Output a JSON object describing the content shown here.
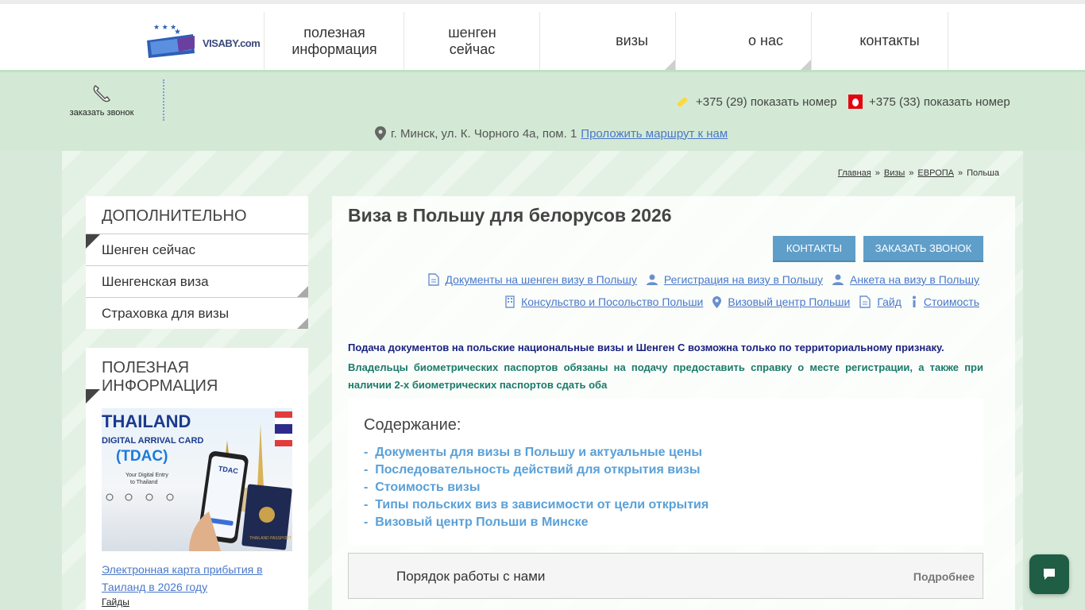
{
  "logo": {
    "text": "VISABY.com"
  },
  "nav": {
    "items": [
      {
        "line1": "полезная",
        "line2": "информация"
      },
      {
        "line1": "шенген",
        "line2": "сейчас"
      },
      {
        "line1": "визы",
        "line2": ""
      },
      {
        "line1": "о нас",
        "line2": ""
      },
      {
        "line1": "контакты",
        "line2": ""
      }
    ]
  },
  "topbar": {
    "callback_label": "заказать звонок",
    "phone1": {
      "number": "+375 (29)",
      "action": "показать номер"
    },
    "phone2": {
      "number": "+375 (33)",
      "action": "показать номер"
    },
    "address": "г. Минск, ул. К. Чорного 4а, пом. 1",
    "route_link": "Проложить маршрут к нам"
  },
  "breadcrumb": {
    "items": [
      "Главная",
      "Визы",
      "ЕВРОПА"
    ],
    "current": "Польша",
    "separator": "»"
  },
  "sidebar": {
    "extra_title": "ДОПОЛНИТЕЛЬНО",
    "extra_items": [
      "Шенген сейчас",
      "Шенгенская виза",
      "Страховка для визы"
    ],
    "info_title": "ПОЛЕЗНАЯ ИНФОРМАЦИЯ",
    "promo": {
      "line1": "THAILAND",
      "line2": "DIGITAL ARRIVAL CARD",
      "line3": "(TDAC)",
      "line4": "Your Digital Entry",
      "line5": "to Thailand",
      "phone_text": "TDAC",
      "passport_text": "THAILAND PASSPORT"
    },
    "article_link": "Электронная карта прибытия в Таиланд в 2026 году",
    "article_tag": "Гайды"
  },
  "main": {
    "title": "Виза в Польшу для белорусов 2026",
    "btn_contacts": "КОНТАКТЫ",
    "btn_callback": "ЗАКАЗАТЬ ЗВОНОК",
    "links_row1": [
      "Документы на шенген визу в Польшу",
      "Регистрация на визу в Польшу",
      "Анкета на визу в Польшу"
    ],
    "links_row2": [
      "Консульство и Посольство Польши",
      "Визовый центр Польши",
      "Гайд",
      "Стоимость"
    ],
    "notice1": "Подача документов на польские национальные визы и Шенген С возможна только по территориальному признаку.",
    "notice2": "Владельцы биометрических паспортов обязаны на подачу предоставить справку о месте регистрации, а также при наличии 2-х биометрических паспортов сдать оба",
    "toc_title": "Содержание:",
    "toc_items": [
      "Документы для визы в Польшу и актуальные цены",
      "Последовательность действий для открытия визы",
      "Стоимость визы",
      "Типы польских виз в зависимости от цели открытия",
      "Визовый центр Польши в Минске"
    ],
    "order_title": "Порядок работы с нами",
    "order_more": "Подробнее"
  },
  "colors": {
    "accent_blue": "#5f9ec9",
    "link": "#4a78c9",
    "green_bg": "#d7ead9",
    "chat": "#1f5e44"
  }
}
